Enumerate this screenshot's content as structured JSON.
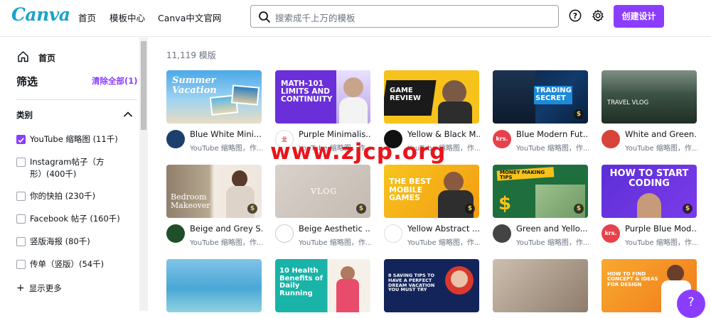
{
  "header": {
    "logo": "Canva",
    "nav": [
      "首页",
      "模板中心",
      "Canva中文官网"
    ],
    "search_placeholder": "搜索成千上万的模板",
    "create_label": "创建设计"
  },
  "sidebar": {
    "home_label": "首页",
    "filter_title": "筛选",
    "clear_all": "清除全部(1)",
    "category_title": "类别",
    "options": [
      {
        "label": "YouTube 缩略图 (11千)",
        "checked": true
      },
      {
        "label": "Instagram帖子（方形）(400千)",
        "checked": false
      },
      {
        "label": "你的快拍 (230千)",
        "checked": false
      },
      {
        "label": "Facebook 帖子 (160千)",
        "checked": false
      },
      {
        "label": "竖版海报 (80千)",
        "checked": false
      },
      {
        "label": "传单（竖版）(54千)",
        "checked": false
      }
    ],
    "show_more": "显示更多"
  },
  "main": {
    "count": "11,119 模版",
    "cards": [
      {
        "title": "Blue White Mini...",
        "sub": "YouTube 缩略图，作...",
        "thumb_text": "Summer Vacation",
        "avatar": "",
        "pro": false
      },
      {
        "title": "Purple Minimalis...",
        "sub": "YouTube 缩略图，作...",
        "thumb_text": "MATH-101 LIMITS AND CONTINUITY",
        "avatar": "㐀",
        "pro": false
      },
      {
        "title": "Yellow & Black M...",
        "sub": "YouTube 缩略图，作...",
        "thumb_text": "GAME REVIEW",
        "avatar": "",
        "pro": false
      },
      {
        "title": "Blue Modern Fut...",
        "sub": "YouTube 缩略图，作...",
        "thumb_text": "TRADING SECRET",
        "avatar": "krs.",
        "pro": true
      },
      {
        "title": "White and Green...",
        "sub": "YouTube 缩略图，作...",
        "thumb_text": "TRAVEL VLOG",
        "avatar": "",
        "pro": false
      },
      {
        "title": "Beige and Grey S...",
        "sub": "YouTube 缩略图，作...",
        "thumb_text": "Bedroom Makeover",
        "avatar": "",
        "pro": true
      },
      {
        "title": "Beige Aesthetic ...",
        "sub": "YouTube 缩略图，作...",
        "thumb_text": "VLOG",
        "avatar": "",
        "pro": true
      },
      {
        "title": "Yellow Abstract ...",
        "sub": "YouTube 缩略图，作...",
        "thumb_text": "THE BEST MOBILE GAMES",
        "avatar": "",
        "pro": true
      },
      {
        "title": "Green and Yello...",
        "sub": "YouTube 缩略图，作...",
        "thumb_text": "MONEY MAKING TIPS",
        "avatar": "",
        "pro": true
      },
      {
        "title": "Purple Blue Mod...",
        "sub": "YouTube 缩略图，作...",
        "thumb_text": "HOW TO START CODING",
        "avatar": "krs.",
        "pro": true
      },
      {
        "title": "",
        "sub": "",
        "thumb_text": "",
        "avatar": "",
        "pro": false
      },
      {
        "title": "",
        "sub": "",
        "thumb_text": "10 Health Benefits of Daily Running",
        "avatar": "",
        "pro": false
      },
      {
        "title": "",
        "sub": "",
        "thumb_text": "8 SAVING TIPS TO HAVE A PERFECT DREAM VACATION YOU MUST TRY",
        "avatar": "",
        "pro": false
      },
      {
        "title": "",
        "sub": "",
        "thumb_text": "",
        "avatar": "",
        "pro": false
      },
      {
        "title": "",
        "sub": "",
        "thumb_text": "HOW TO FIND CONCEPT & IDEAS FOR DESIGN",
        "avatar": "",
        "pro": false
      }
    ]
  },
  "watermark": "www.zjcp.org",
  "help_label": "?",
  "colors": {
    "accent": "#8b3dff",
    "logo": "#19a3c9",
    "watermark": "#e8151b"
  }
}
